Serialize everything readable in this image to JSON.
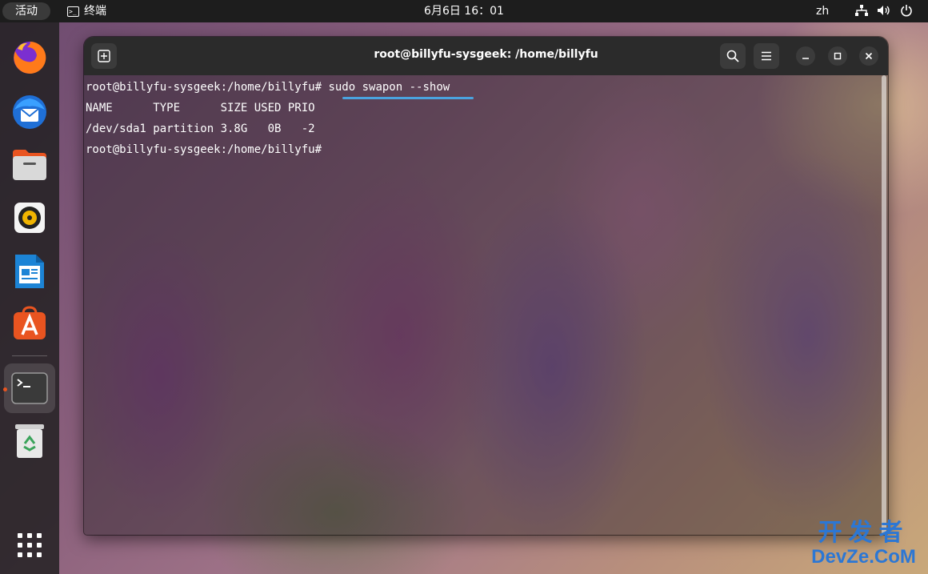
{
  "topbar": {
    "activities": "活动",
    "app_name": "终端",
    "clock": "6月6日 16：01",
    "language": "zh",
    "tray_icons": [
      "network-icon",
      "volume-icon",
      "power-icon"
    ]
  },
  "dock": {
    "apps": [
      "firefox",
      "thunderbird",
      "files",
      "rhythmbox",
      "libreoffice-writer",
      "app-center",
      "terminal",
      "trash",
      "show-apps"
    ],
    "active": "terminal"
  },
  "window": {
    "title": "root@billyfu-sysgeek: /home/billyfu"
  },
  "terminal": {
    "prompt": "root@billyfu-sysgeek:/home/billyfu#",
    "command": "sudo swapon --show",
    "output_header": "NAME      TYPE      SIZE USED PRIO",
    "output_row": "/dev/sda1 partition 3.8G   0B   -2"
  },
  "watermark": {
    "cn": "开发者",
    "en": "DevZe.CoM"
  },
  "colors": {
    "accent": "#e95420",
    "underline": "#4aa3df",
    "watermark": "#2c77d4"
  }
}
